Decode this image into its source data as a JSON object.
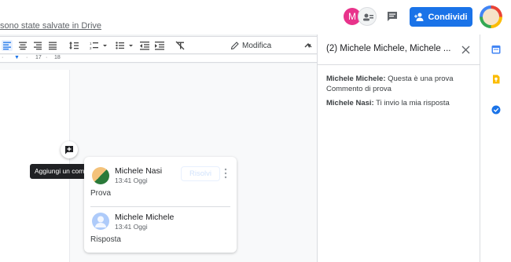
{
  "header": {
    "save_status": "sono state salvate in Drive",
    "avatar_initial": "M",
    "share_label": "Condividi"
  },
  "toolbar": {
    "edit_mode_label": "Modifica"
  },
  "ruler": {
    "ticks": [
      "17",
      "18"
    ]
  },
  "tooltip": {
    "add_comment": "Aggiungi un commento"
  },
  "comment_card": {
    "entries": [
      {
        "name": "Michele Nasi",
        "time": "13:41 Oggi",
        "text": "Prova"
      },
      {
        "name": "Michele Michele",
        "time": "13:41 Oggi",
        "text": "Risposta"
      }
    ],
    "resolve_label": "Risolvi"
  },
  "panel": {
    "title": "(2) Michele Michele, Michele ...",
    "lines": [
      {
        "author": "Michele Michele:",
        "text": " Questa è una prova"
      },
      {
        "author": "",
        "text": "Commento di prova"
      },
      {
        "author": "Michele Nasi:",
        "text": " Ti invio la mia risposta"
      }
    ]
  },
  "colors": {
    "accent": "#1a73e8",
    "tooltip_bg": "#202124",
    "avatar_m": "#e8338b"
  },
  "icons": [
    "align-left-icon",
    "align-center-icon",
    "align-right-icon",
    "justify-icon",
    "line-spacing-icon",
    "numbered-list-icon",
    "bulleted-list-icon",
    "decrease-indent-icon",
    "increase-indent-icon",
    "clear-formatting-icon",
    "pencil-icon",
    "chevron-up-icon",
    "chat-icon",
    "add-person-icon",
    "add-comment-icon",
    "more-vert-icon",
    "close-icon",
    "calendar-icon",
    "keep-icon",
    "tasks-icon"
  ]
}
